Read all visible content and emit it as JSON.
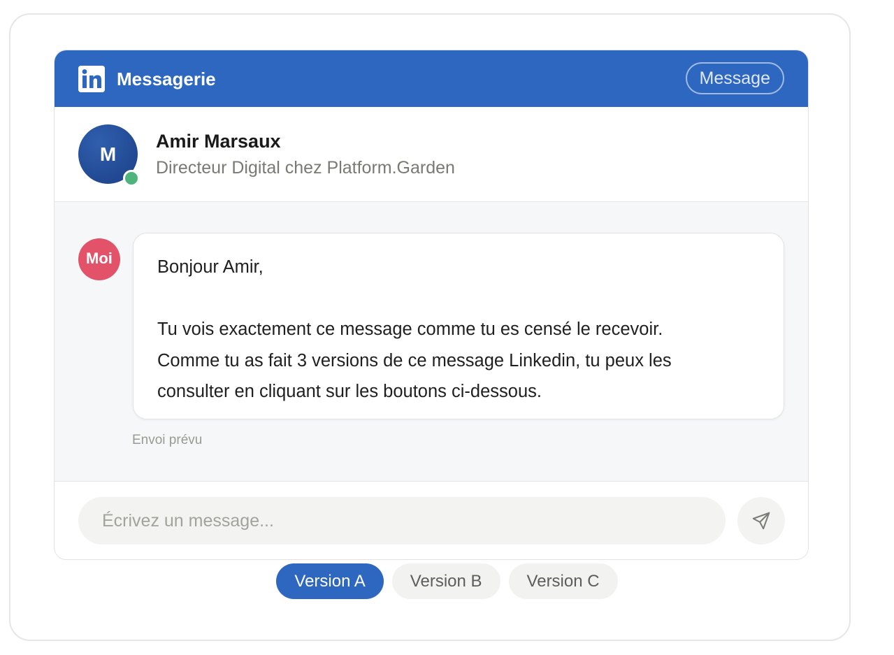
{
  "header": {
    "logo_text": "in",
    "title": "Messagerie",
    "message_button_label": "Message",
    "color": "#2e67bf"
  },
  "contact": {
    "avatar_initial": "M",
    "name": "Amir Marsaux",
    "subtitle": "Directeur Digital chez Platform.Garden",
    "status": "online"
  },
  "conversation": {
    "sender_avatar_label": "Moi",
    "message": {
      "greeting": "Bonjour Amir,",
      "body_lines": [
        "Tu vois exactement ce message comme tu es censé le recevoir.",
        "Comme tu as fait 3 versions de ce message Linkedin, tu peux les",
        "consulter en cliquant sur les boutons ci-dessous."
      ]
    },
    "status_text": "Envoi prévu"
  },
  "composer": {
    "placeholder": "Écrivez un message...",
    "value": "",
    "send_icon": "send-icon"
  },
  "versions": {
    "selected": "Version A",
    "items": [
      "Version A",
      "Version B",
      "Version C"
    ]
  },
  "colors": {
    "accent": "#2e67bf",
    "me_avatar": "#e2536a",
    "online": "#4fb37c"
  }
}
